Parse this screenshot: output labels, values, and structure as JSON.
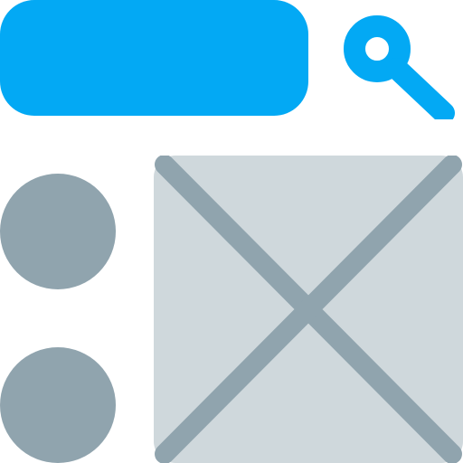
{
  "colors": {
    "accent": "#03A9F4",
    "placeholder_fill": "#CFD8DC",
    "placeholder_stroke": "#90A4AE",
    "list_dot": "#90A4AE",
    "background": "#FFFFFF"
  },
  "header": {
    "search_bar": {
      "icon": "search-icon"
    }
  },
  "sidebar": {
    "items": [
      {
        "icon": "circle-bullet"
      },
      {
        "icon": "circle-bullet"
      }
    ]
  },
  "main": {
    "media": {
      "icon": "image-placeholder-icon"
    }
  }
}
